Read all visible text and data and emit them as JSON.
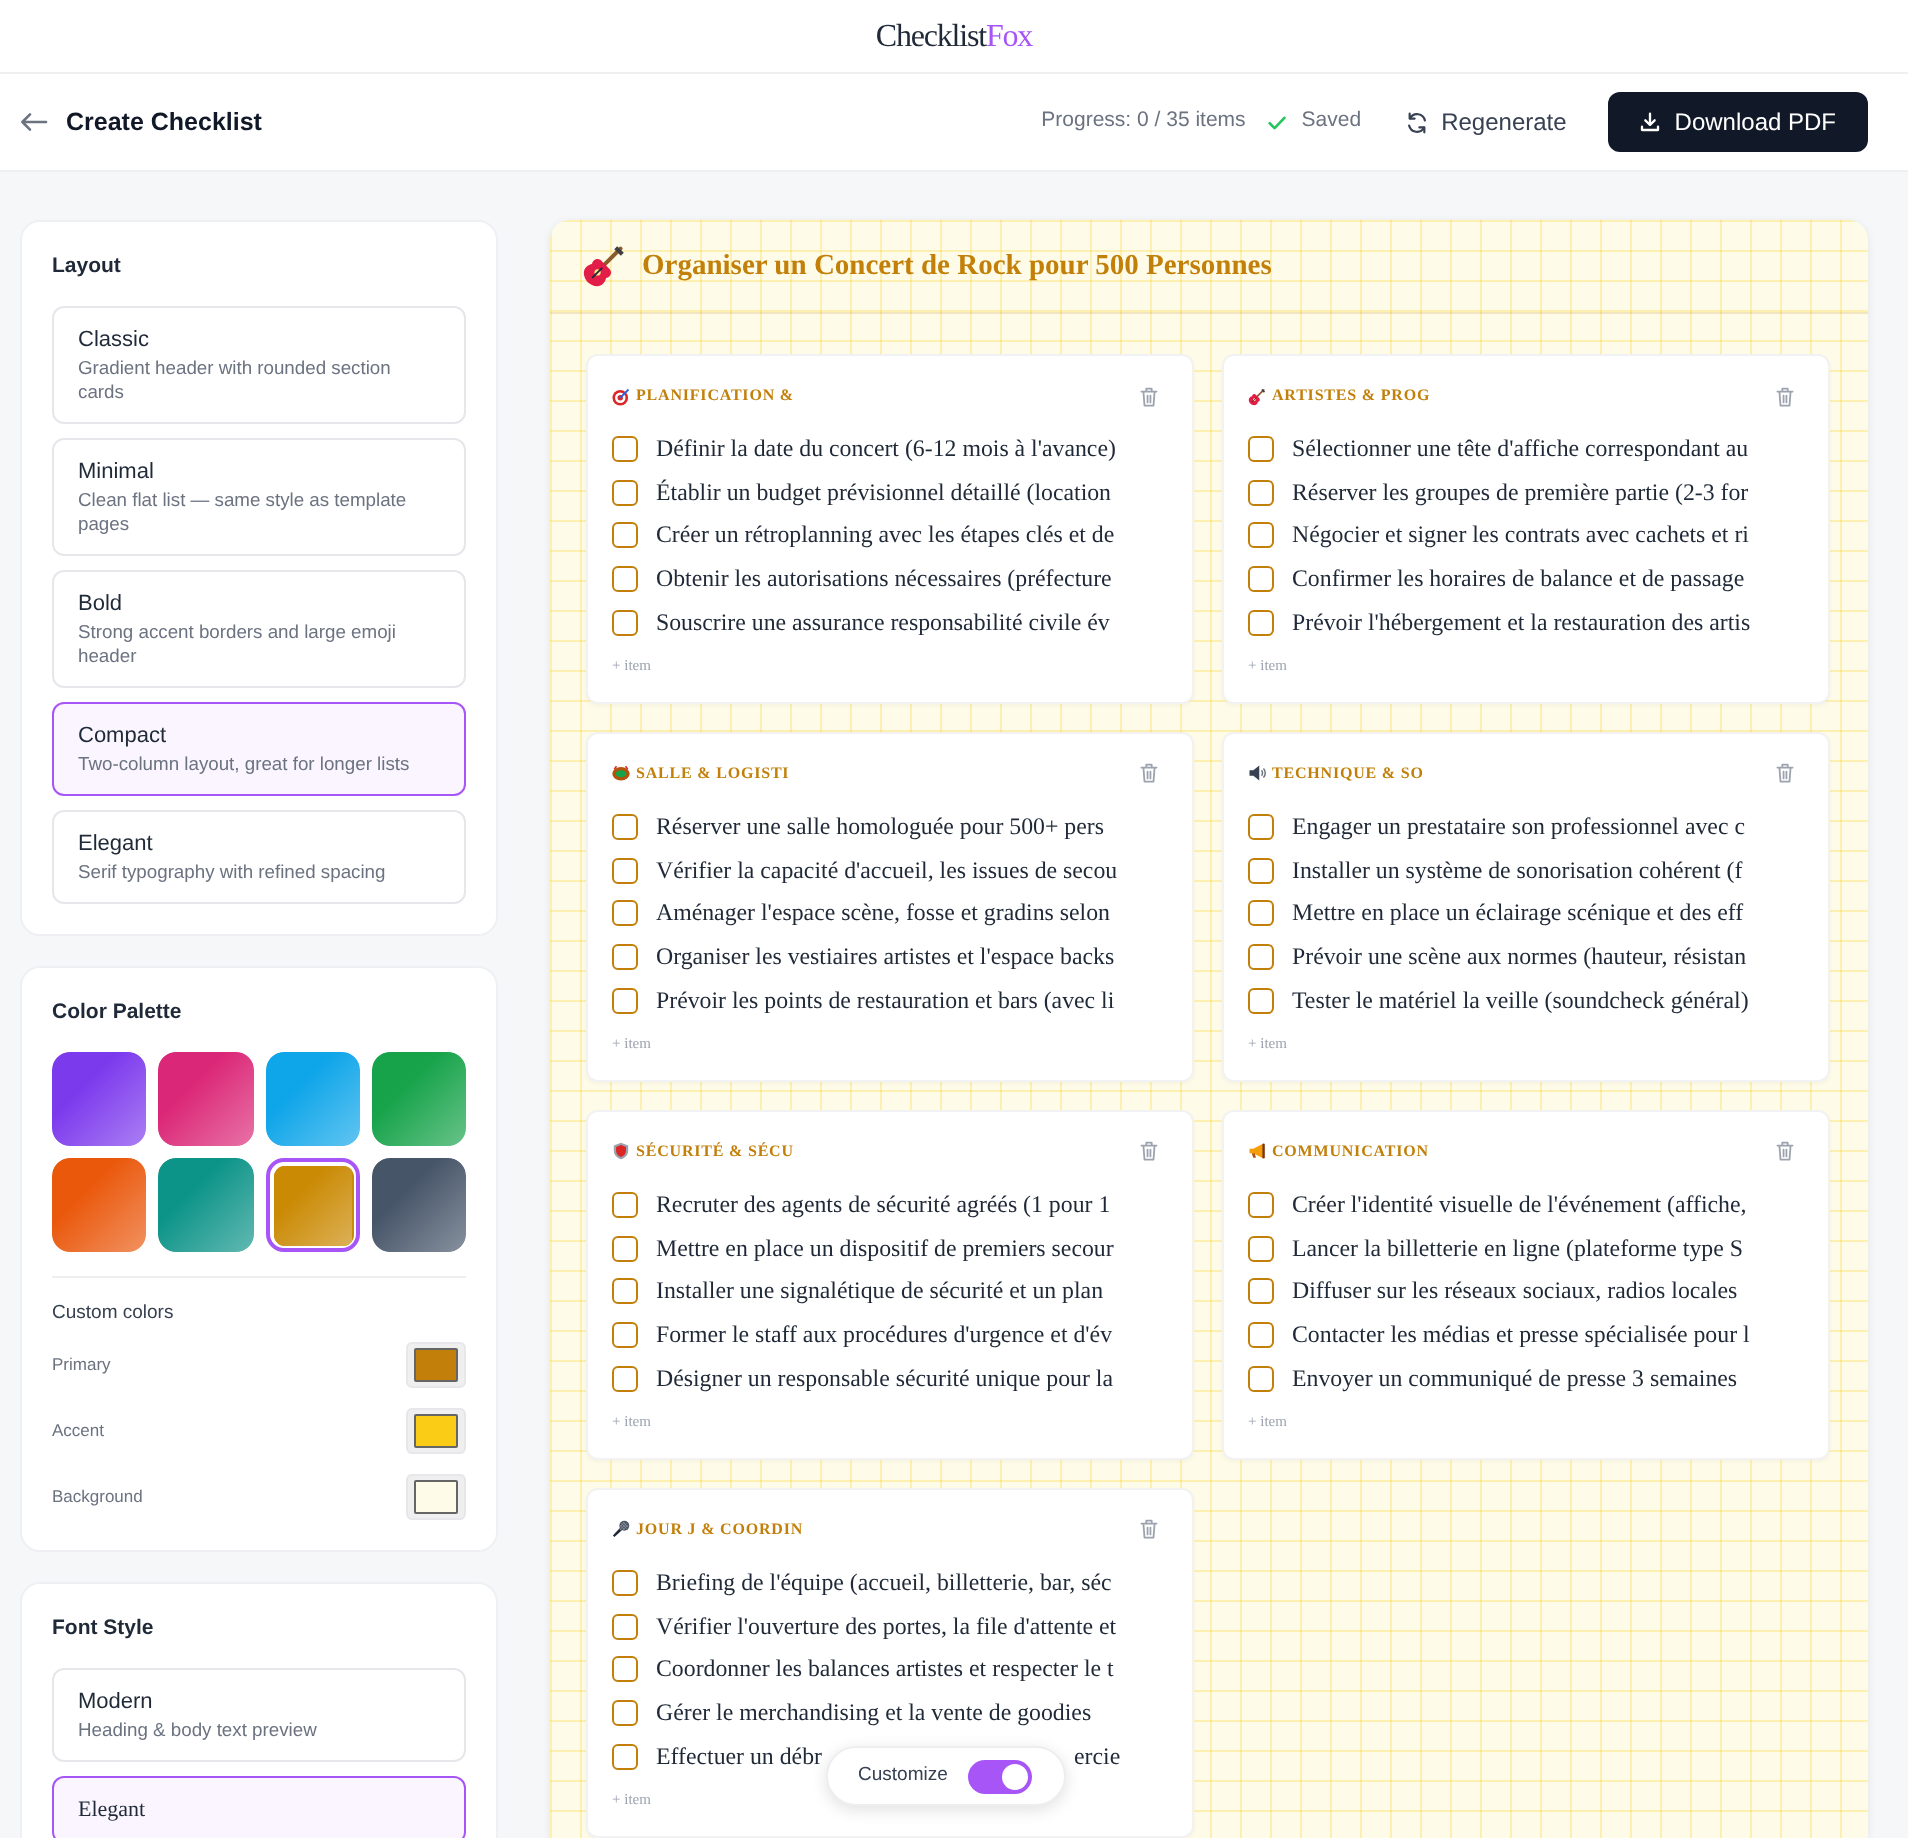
{
  "brand": {
    "name": "Checklist",
    "accent": "Fox"
  },
  "toolbar": {
    "title": "Create Checklist",
    "progress": "Progress: 0 / 35 items",
    "saved": "Saved",
    "regenerate": {
      "label": "Regenerate"
    },
    "download": {
      "label": "Download PDF"
    }
  },
  "sidebar": {
    "layout": {
      "title": "Layout",
      "options": [
        {
          "name": "Classic",
          "description": "Gradient header with rounded section cards",
          "selected": false
        },
        {
          "name": "Minimal",
          "description": "Clean flat list — same style as template pages",
          "selected": false
        },
        {
          "name": "Bold",
          "description": "Strong accent borders and large emoji header",
          "selected": false
        },
        {
          "name": "Compact",
          "description": "Two-column layout, great for longer lists",
          "selected": true
        },
        {
          "name": "Elegant",
          "description": "Serif typography with refined spacing",
          "selected": false
        }
      ]
    },
    "palette": {
      "title": "Color Palette",
      "swatches": [
        {
          "color": "#7c3aed",
          "selected": false
        },
        {
          "color": "#db2777",
          "selected": false
        },
        {
          "color": "#0ea5e9",
          "selected": false
        },
        {
          "color": "#16a34a",
          "selected": false
        },
        {
          "color": "#ea580c",
          "selected": false
        },
        {
          "color": "#0d9488",
          "selected": false
        },
        {
          "color": "#ca8a04",
          "selected": true
        },
        {
          "color": "#475569",
          "selected": false
        }
      ],
      "custom_title": "Custom colors",
      "custom": [
        {
          "kind": "primary",
          "label": "Primary",
          "color": "#c2800a"
        },
        {
          "kind": "accent",
          "label": "Accent",
          "color": "#facc15"
        },
        {
          "kind": "background",
          "label": "Background",
          "color": "#fefce8"
        }
      ]
    },
    "font_style": {
      "title": "Font Style",
      "options": [
        {
          "kind": "sans",
          "name": "Modern",
          "description": "Heading & body text preview",
          "selected": false
        },
        {
          "kind": "serif",
          "name": "Elegant",
          "selected": true
        }
      ]
    }
  },
  "checklist": {
    "title": "Organiser un Concert de Rock pour 500 Personnes",
    "sections": [
      {
        "title": "PLANIFICATION &",
        "add_label": "+ item",
        "items": [
          {
            "text": "Définir la date du concert (6-12 mois à l'avance)",
            "checked": false
          },
          {
            "text": "Établir un budget prévisionnel détaillé (location",
            "checked": false
          },
          {
            "text": "Créer un rétroplanning avec les étapes clés et de",
            "checked": false
          },
          {
            "text": "Obtenir les autorisations nécessaires (préfecture",
            "checked": false
          },
          {
            "text": "Souscrire une assurance responsabilité civile év",
            "checked": false
          }
        ]
      },
      {
        "title": "ARTISTES & PROG",
        "add_label": "+ item",
        "items": [
          {
            "text": "Sélectionner une tête d'affiche correspondant au",
            "checked": false
          },
          {
            "text": "Réserver les groupes de première partie (2-3 for",
            "checked": false
          },
          {
            "text": "Négocier et signer les contrats avec cachets et ri",
            "checked": false
          },
          {
            "text": "Confirmer les horaires de balance et de passage",
            "checked": false
          },
          {
            "text": "Prévoir l'hébergement et la restauration des artis",
            "checked": false
          }
        ]
      },
      {
        "title": "SALLE & LOGISTI",
        "add_label": "+ item",
        "items": [
          {
            "text": "Réserver une salle homologuée pour 500+ pers",
            "checked": false
          },
          {
            "text": "Vérifier la capacité d'accueil, les issues de secou",
            "checked": false
          },
          {
            "text": "Aménager l'espace scène, fosse et gradins selon",
            "checked": false
          },
          {
            "text": "Organiser les vestiaires artistes et l'espace backs",
            "checked": false
          },
          {
            "text": "Prévoir les points de restauration et bars (avec li",
            "checked": false
          }
        ]
      },
      {
        "title": "TECHNIQUE & SO",
        "add_label": "+ item",
        "items": [
          {
            "text": "Engager un prestataire son professionnel avec c",
            "checked": false
          },
          {
            "text": "Installer un système de sonorisation cohérent (f",
            "checked": false
          },
          {
            "text": "Mettre en place un éclairage scénique et des eff",
            "checked": false
          },
          {
            "text": "Prévoir une scène aux normes (hauteur, résistan",
            "checked": false
          },
          {
            "text": "Tester le matériel la veille (soundcheck général)",
            "checked": false
          }
        ]
      },
      {
        "title": "SÉCURITÉ & SÉCU",
        "add_label": "+ item",
        "items": [
          {
            "text": "Recruter des agents de sécurité agréés (1 pour 1",
            "checked": false
          },
          {
            "text": "Mettre en place un dispositif de premiers secour",
            "checked": false
          },
          {
            "text": "Installer une signalétique de sécurité et un plan",
            "checked": false
          },
          {
            "text": "Former le staff aux procédures d'urgence et d'év",
            "checked": false
          },
          {
            "text": "Désigner un responsable sécurité unique pour la",
            "checked": false
          }
        ]
      },
      {
        "title": "COMMUNICATION",
        "add_label": "+ item",
        "items": [
          {
            "text": "Créer l'identité visuelle de l'événement (affiche,",
            "checked": false
          },
          {
            "text": "Lancer la billetterie en ligne (plateforme type S",
            "checked": false
          },
          {
            "text": "Diffuser sur les réseaux sociaux, radios locales",
            "checked": false
          },
          {
            "text": "Contacter les médias et presse spécialisée pour l",
            "checked": false
          },
          {
            "text": "Envoyer un communiqué de presse 3 semaines",
            "checked": false
          }
        ]
      },
      {
        "title": "JOUR J & COORDIN",
        "add_label": "+ item",
        "items": [
          {
            "text": "Briefing de l'équipe (accueil, billetterie, bar, séc",
            "checked": false
          },
          {
            "text": "Vérifier l'ouverture des portes, la file d'attente et",
            "checked": false
          },
          {
            "text": "Coordonner les balances artistes et respecter le t",
            "checked": false
          },
          {
            "text": "Gérer le merchandising et la vente de goodies",
            "checked": false
          },
          {
            "text": "Effectuer un débr",
            "text_tail": "ercie",
            "checked": false
          }
        ]
      }
    ]
  },
  "customize": {
    "label": "Customize",
    "on": true
  }
}
